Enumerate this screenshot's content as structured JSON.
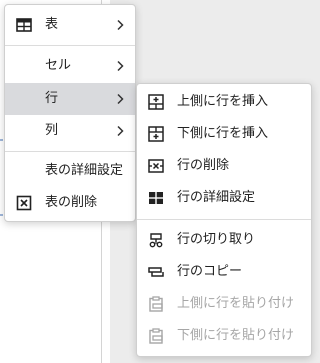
{
  "menu": {
    "items": [
      {
        "label": "表",
        "icon": "table-icon",
        "has_submenu": true
      },
      {
        "label": "セル",
        "has_submenu": true
      },
      {
        "label": "行",
        "has_submenu": true,
        "active": true
      },
      {
        "label": "列",
        "has_submenu": true
      },
      {
        "label": "表の詳細設定"
      },
      {
        "label": "表の削除",
        "icon": "delete-table-icon"
      }
    ]
  },
  "row_submenu": {
    "items": [
      {
        "label": "上側に行を挿入",
        "icon": "insert-row-above-icon",
        "enabled": true
      },
      {
        "label": "下側に行を挿入",
        "icon": "insert-row-below-icon",
        "enabled": true
      },
      {
        "label": "行の削除",
        "icon": "delete-row-icon",
        "enabled": true
      },
      {
        "label": "行の詳細設定",
        "icon": "row-properties-icon",
        "enabled": true
      },
      {
        "label": "行の切り取り",
        "icon": "cut-icon",
        "enabled": true
      },
      {
        "label": "行のコピー",
        "icon": "copy-icon",
        "enabled": true
      },
      {
        "label": "上側に行を貼り付け",
        "icon": "paste-icon",
        "enabled": false
      },
      {
        "label": "下側に行を貼り付け",
        "icon": "paste-icon",
        "enabled": false
      }
    ]
  },
  "colors": {
    "active_bg": "#d9dadd",
    "disabled_text": "#a6a6a6",
    "text": "#222222"
  }
}
